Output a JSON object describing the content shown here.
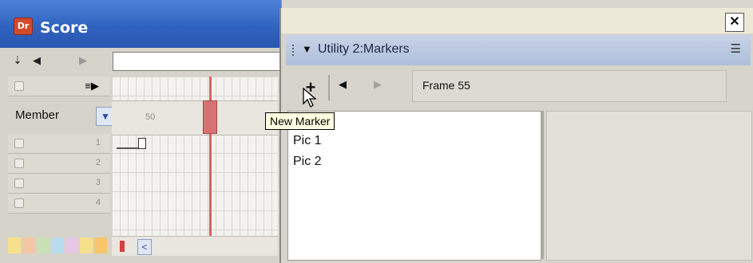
{
  "score_window": {
    "title": "Score",
    "app_badge": "Dr",
    "member_label": "Member",
    "ruler_label": "50",
    "channel_numbers": [
      "1",
      "2",
      "3",
      "4"
    ],
    "palette_colors": [
      "#f6e08c",
      "#f3c7a4",
      "#c9e0b5",
      "#b9dcec",
      "#e6c7e6",
      "#f6e08c",
      "#f9c56a"
    ]
  },
  "markers_panel": {
    "title": "Utility 2:Markers",
    "close_label": "✕",
    "frame_label": "Frame 55",
    "tooltip": "New Marker",
    "markers": [
      "Pic 1",
      "Pic 2"
    ]
  }
}
